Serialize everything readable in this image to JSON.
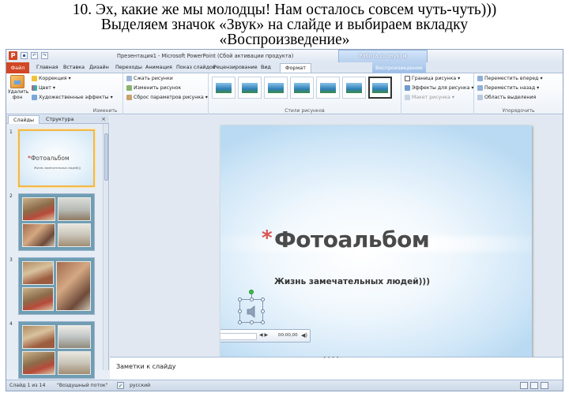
{
  "caption": {
    "line1": "10. Эх, какие же мы молодцы! Нам осталось совсем чуть-чуть)))",
    "line2": "Выделяем значок «Звук» на слайде и выбираем вкладку",
    "line3": "«Воспроизведение»"
  },
  "window": {
    "title": "Презентация1 - Microsoft PowerPoint (Сбой активации продукта)",
    "context_title": "Работа со звуком",
    "app_letter": "P"
  },
  "tabs": {
    "file": "Файл",
    "home": "Главная",
    "insert": "Вставка",
    "design": "Дизайн",
    "transitions": "Переходы",
    "animation": "Анимация",
    "slideshow": "Показ слайдов",
    "review": "Рецензирование",
    "view": "Вид",
    "format": "Формат",
    "playback": "Воспроизведение"
  },
  "ribbon": {
    "remove_bg": "Удалить фон",
    "correction": "Коррекция",
    "color": "Цвет",
    "artistic": "Художественные эффекты",
    "compress": "Сжать рисунки",
    "change": "Изменить рисунок",
    "reset": "Сброс параметров рисунка",
    "group_change": "Изменить",
    "group_styles": "Стили рисунков",
    "border": "Граница рисунка",
    "effects": "Эффекты для рисунка",
    "layout": "Макет рисунка",
    "bring_forward": "Переместить вперед",
    "send_back": "Переместить назад",
    "selection_pane": "Область выделения",
    "group_arrange": "Упорядочить"
  },
  "left_pane": {
    "tab_slides": "Слайды",
    "tab_outline": "Структура",
    "close": "×",
    "slides": [
      {
        "num": "1",
        "title": "Фотоальбом",
        "sub": "Жизнь замечательных людей)))"
      },
      {
        "num": "2"
      },
      {
        "num": "3"
      },
      {
        "num": "4"
      }
    ]
  },
  "slide": {
    "title": "Фотоальбом",
    "subtitle": "Жизнь замечательных людей)))"
  },
  "player": {
    "time": "00:00,00"
  },
  "notes": {
    "placeholder": "Заметки к слайду"
  },
  "statusbar": {
    "slide_count": "Слайд 1 из 14",
    "theme": "\"Воздушный поток\"",
    "language": "русский"
  },
  "colors": {
    "file_tab": "#d24726",
    "accent": "#d9534f",
    "context_tab": "#b9d3f1"
  }
}
